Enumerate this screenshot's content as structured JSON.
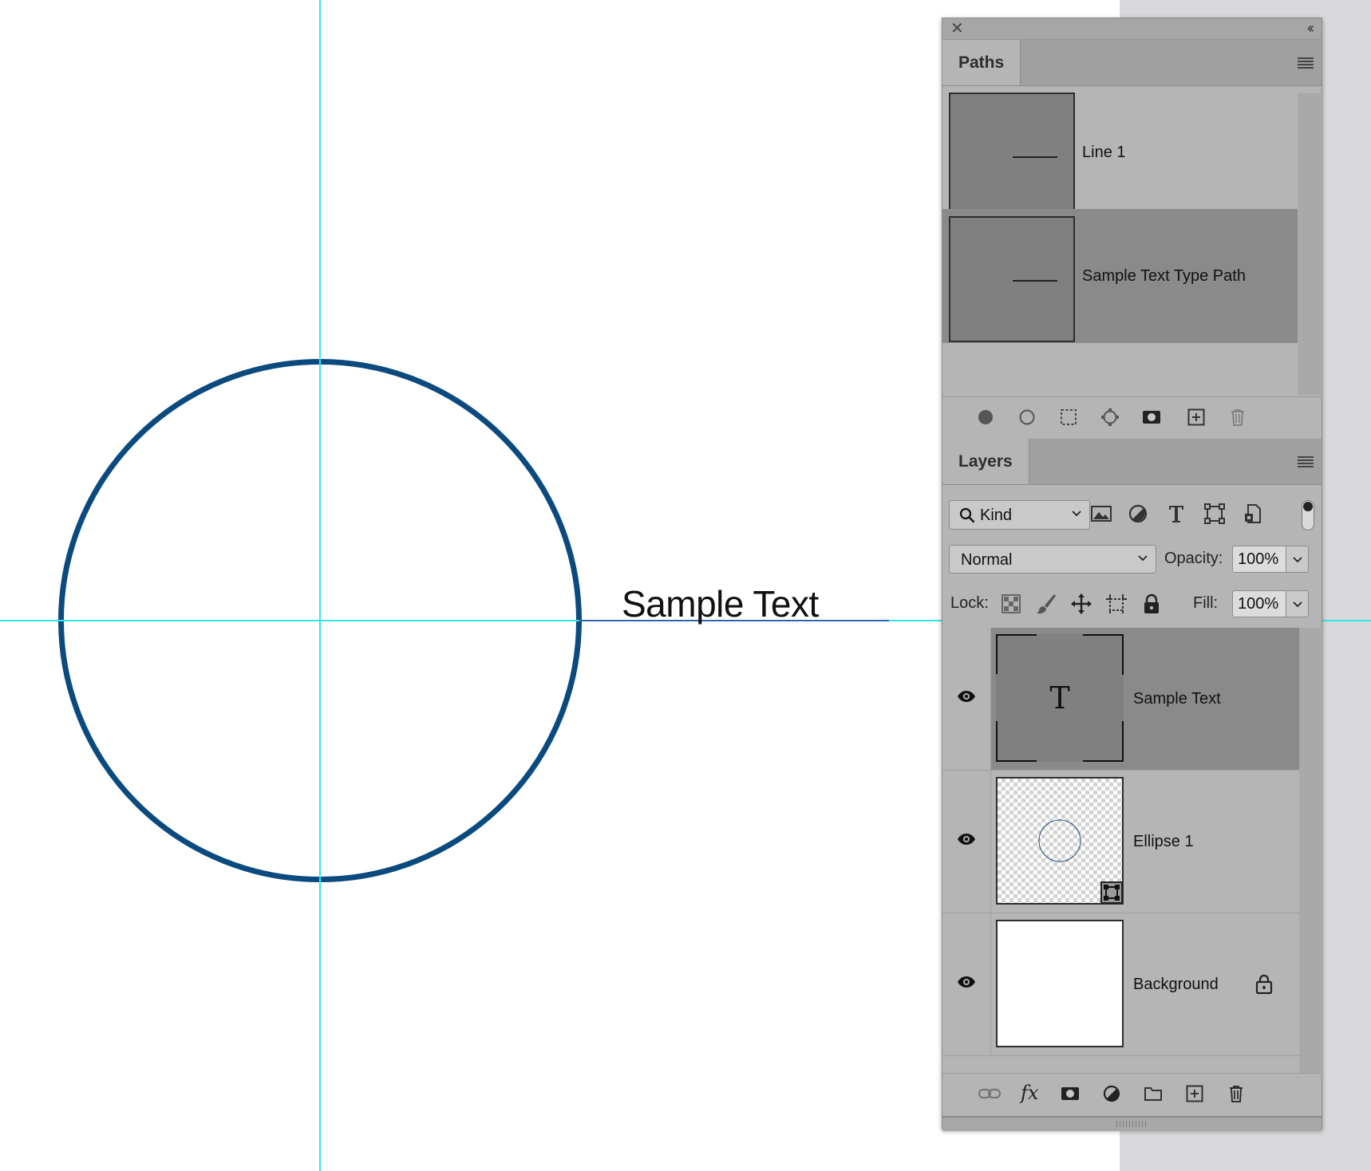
{
  "canvas": {
    "sample_text": "Sample Text",
    "colors": {
      "guide": "#35e5ee",
      "ellipse_stroke": "#0b4a7e",
      "text_path": "#2f63b5"
    }
  },
  "paths_panel": {
    "tab_label": "Paths",
    "items": [
      {
        "label": "Line 1",
        "selected": false
      },
      {
        "label": "Sample Text Type Path",
        "selected": true
      }
    ],
    "footer_icons": [
      "fill-path-icon",
      "stroke-path-icon",
      "load-selection-icon",
      "make-work-path-icon",
      "add-mask-icon",
      "new-path-icon",
      "delete-path-icon"
    ]
  },
  "layers_panel": {
    "tab_label": "Layers",
    "filter": {
      "kind_label": "Kind"
    },
    "filter_icons": [
      "pixel-filter-icon",
      "adjustment-filter-icon",
      "type-filter-icon",
      "shape-filter-icon",
      "smart-object-filter-icon"
    ],
    "blend_mode": "Normal",
    "opacity_label": "Opacity:",
    "opacity_value": "100%",
    "lock_label": "Lock:",
    "fill_label": "Fill:",
    "fill_value": "100%",
    "layers": [
      {
        "name": "Sample Text",
        "type": "type",
        "thumb_glyph": "T",
        "visible": true,
        "selected": true
      },
      {
        "name": "Ellipse 1",
        "type": "shape",
        "visible": true,
        "selected": false
      },
      {
        "name": "Background",
        "type": "pixel",
        "visible": true,
        "selected": false,
        "locked": true
      }
    ],
    "footer_icons": [
      "link-layers-icon",
      "fx-icon",
      "add-mask-icon",
      "adjustment-layer-icon",
      "new-group-icon",
      "new-layer-icon",
      "delete-layer-icon"
    ],
    "fx_label": "fx"
  }
}
